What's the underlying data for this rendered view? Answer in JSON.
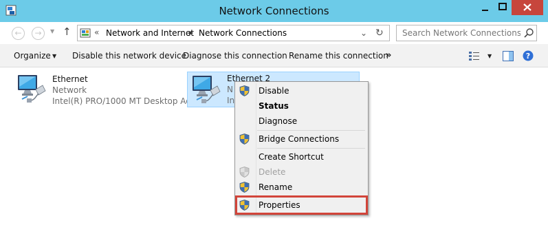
{
  "window": {
    "title": "Network Connections",
    "colors": {
      "titlebar": "#6ccbe8",
      "close_button": "#c7463c",
      "selection": "#cce8ff",
      "highlight_box": "#d2453a"
    }
  },
  "address_bar": {
    "separator": "«",
    "breadcrumbs": [
      "Network and Internet",
      "Network Connections"
    ]
  },
  "search": {
    "placeholder": "Search Network Connections"
  },
  "toolbar": {
    "organize": "Organize",
    "disable": "Disable this network device",
    "diagnose": "Diagnose this connection",
    "rename": "Rename this connection",
    "more": "»"
  },
  "adapters": [
    {
      "name": "Ethernet",
      "network": "Network",
      "device": "Intel(R) PRO/1000 MT Desktop Ad...",
      "selected": false
    },
    {
      "name": "Ethernet 2",
      "network": "N",
      "device": "Int",
      "selected": true
    }
  ],
  "context_menu": {
    "items": [
      {
        "label": "Disable",
        "icon": "uac-shield-icon",
        "bold": false,
        "enabled": true
      },
      {
        "label": "Status",
        "icon": null,
        "bold": true,
        "enabled": true
      },
      {
        "label": "Diagnose",
        "icon": null,
        "bold": false,
        "enabled": true
      },
      {
        "label": "Bridge Connections",
        "icon": "uac-shield-icon",
        "bold": false,
        "enabled": true
      },
      {
        "label": "Create Shortcut",
        "icon": null,
        "bold": false,
        "enabled": true
      },
      {
        "label": "Delete",
        "icon": "uac-shield-icon",
        "bold": false,
        "enabled": false
      },
      {
        "label": "Rename",
        "icon": "uac-shield-icon",
        "bold": false,
        "enabled": true
      },
      {
        "label": "Properties",
        "icon": "uac-shield-icon",
        "bold": false,
        "enabled": true,
        "highlighted": true
      }
    ]
  }
}
